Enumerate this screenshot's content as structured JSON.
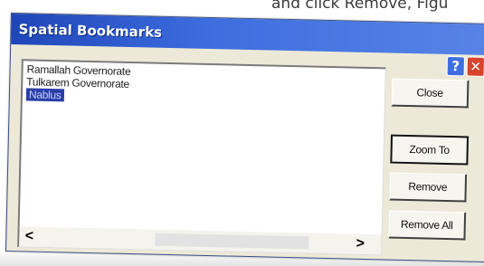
{
  "page_caption": "and click Remove, Figu",
  "dialog": {
    "title": "Spatial Bookmarks",
    "help_label": "?",
    "close_label": "✕"
  },
  "bookmarks": [
    {
      "label": "Ramallah Governorate",
      "selected": false
    },
    {
      "label": "Tulkarem Governorate",
      "selected": false
    },
    {
      "label": "Nablus",
      "selected": true
    }
  ],
  "scrollbar": {
    "left_arrow": "<",
    "right_arrow": ">"
  },
  "buttons": {
    "close": "Close",
    "zoom_to": "Zoom To",
    "remove": "Remove",
    "remove_all": "Remove All"
  }
}
